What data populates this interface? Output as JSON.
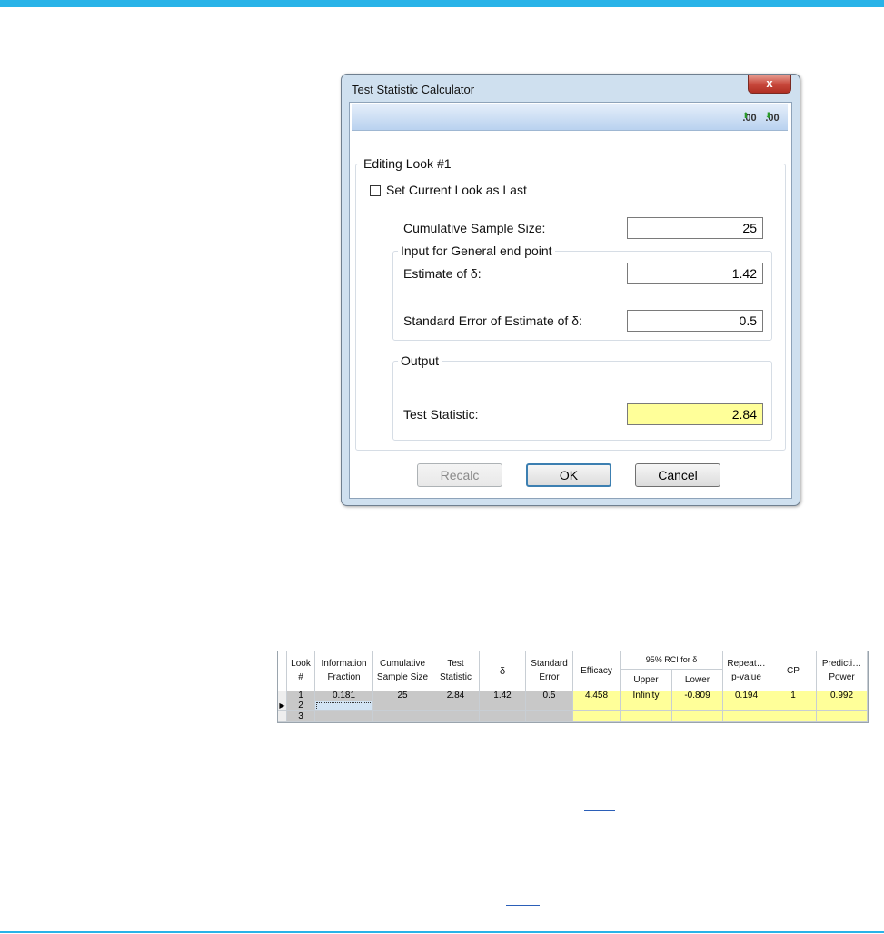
{
  "dialog": {
    "title": "Test Statistic Calculator",
    "close_label": "x",
    "toolbar": {
      "increase_decimals_label": ".00",
      "decrease_decimals_label": ".00"
    },
    "editing_group_legend": "Editing Look #1",
    "set_current_look_label": "Set Current Look as Last",
    "set_current_look_checked": false,
    "cumulative_sample_size_label": "Cumulative Sample Size:",
    "cumulative_sample_size_value": "25",
    "input_group_legend": "Input for General end point",
    "estimate_label": "Estimate of δ:",
    "estimate_value": "1.42",
    "std_error_label": "Standard Error of Estimate of δ:",
    "std_error_value": "0.5",
    "output_group_legend": "Output",
    "test_statistic_label": "Test Statistic:",
    "test_statistic_value": "2.84",
    "buttons": {
      "recalc": "Recalc",
      "ok": "OK",
      "cancel": "Cancel"
    }
  },
  "grid": {
    "headers": {
      "look_1": "Look",
      "look_2": "#",
      "info_1": "Information",
      "info_2": "Fraction",
      "cum_1": "Cumulative",
      "cum_2": "Sample Size",
      "test_1": "Test",
      "test_2": "Statistic",
      "delta": "δ",
      "se_1": "Standard",
      "se_2": "Error",
      "efficacy": "Efficacy",
      "rci_group": "95% RCI for δ",
      "upper": "Upper",
      "lower": "Lower",
      "repeat_1": "Repeat…",
      "repeat_2": "p-value",
      "cp": "CP",
      "pred_1": "Predicti…",
      "pred_2": "Power"
    },
    "rows": [
      {
        "look": "1",
        "info_fraction": "0.181",
        "cum_sample_size": "25",
        "test_statistic": "2.84",
        "delta": "1.42",
        "std_error": "0.5",
        "efficacy": "4.458",
        "upper": "Infinity",
        "lower": "-0.809",
        "repeat_p": "0.194",
        "cp": "1",
        "pred_power": "0.992"
      },
      {
        "look": "2",
        "info_fraction": "",
        "cum_sample_size": "",
        "test_statistic": "",
        "delta": "",
        "std_error": "",
        "efficacy": "",
        "upper": "",
        "lower": "",
        "repeat_p": "",
        "cp": "",
        "pred_power": ""
      },
      {
        "look": "3",
        "info_fraction": "",
        "cum_sample_size": "",
        "test_statistic": "",
        "delta": "",
        "std_error": "",
        "efficacy": "",
        "upper": "",
        "lower": "",
        "repeat_p": "",
        "cp": "",
        "pred_power": ""
      }
    ],
    "current_row_marker": "▶"
  },
  "colors": {
    "accent_bar": "#29b3e8",
    "output_fill": "#ffff99",
    "input_fill_gray": "#c8c8c8"
  }
}
